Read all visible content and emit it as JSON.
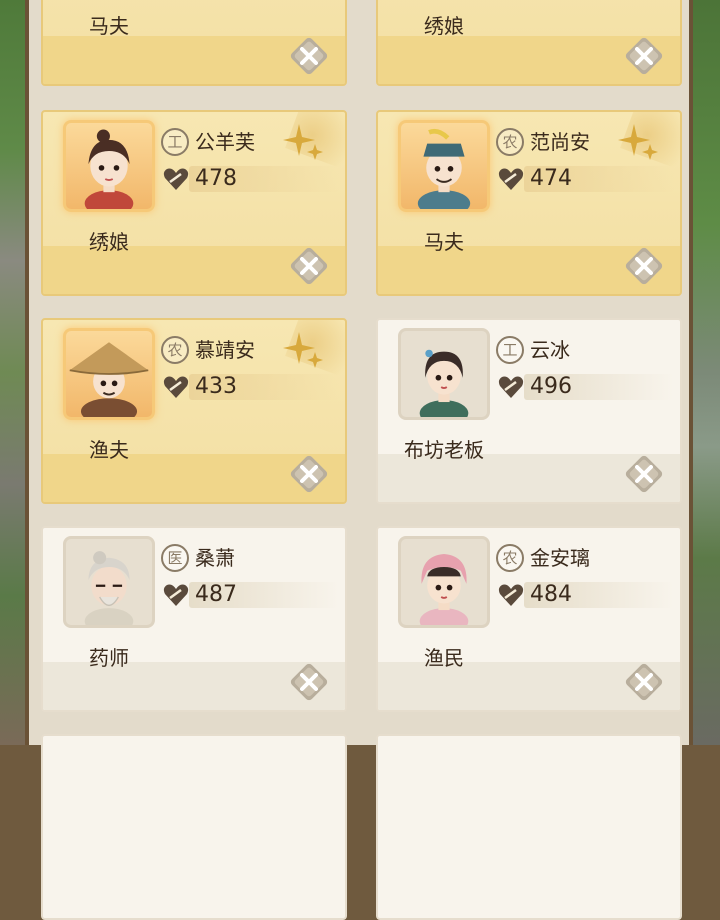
{
  "accent": {
    "gold_card": "#f3dfa3",
    "plain_card": "#f8f4ec",
    "frame": "#6a5236",
    "text": "#3a2a1c"
  },
  "top_cards": [
    {
      "role": "马夫",
      "style": "gold"
    },
    {
      "role": "绣娘",
      "style": "gold"
    }
  ],
  "cards": [
    {
      "role": "绣娘",
      "trait": "工",
      "name": "公羊芙",
      "value": "478",
      "style": "gold",
      "portrait_icon": "embroidery-woman-portrait"
    },
    {
      "role": "马夫",
      "trait": "农",
      "name": "范尚安",
      "value": "474",
      "style": "gold",
      "portrait_icon": "groom-man-portrait"
    },
    {
      "role": "渔夫",
      "trait": "农",
      "name": "慕靖安",
      "value": "433",
      "style": "gold",
      "portrait_icon": "fisherman-portrait"
    },
    {
      "role": "布坊老板",
      "trait": "工",
      "name": "云冰",
      "value": "496",
      "style": "plain",
      "portrait_icon": "cloth-shop-owner-portrait"
    },
    {
      "role": "药师",
      "trait": "医",
      "name": "桑萧",
      "value": "487",
      "style": "plain",
      "portrait_icon": "pharmacist-portrait"
    },
    {
      "role": "渔民",
      "trait": "农",
      "name": "金安璃",
      "value": "484",
      "style": "plain",
      "portrait_icon": "fisherwoman-portrait"
    }
  ],
  "icons": {
    "value_icon": "heart-icon",
    "close_icon": "close-icon",
    "rare_icon": "sparkle-icon"
  }
}
